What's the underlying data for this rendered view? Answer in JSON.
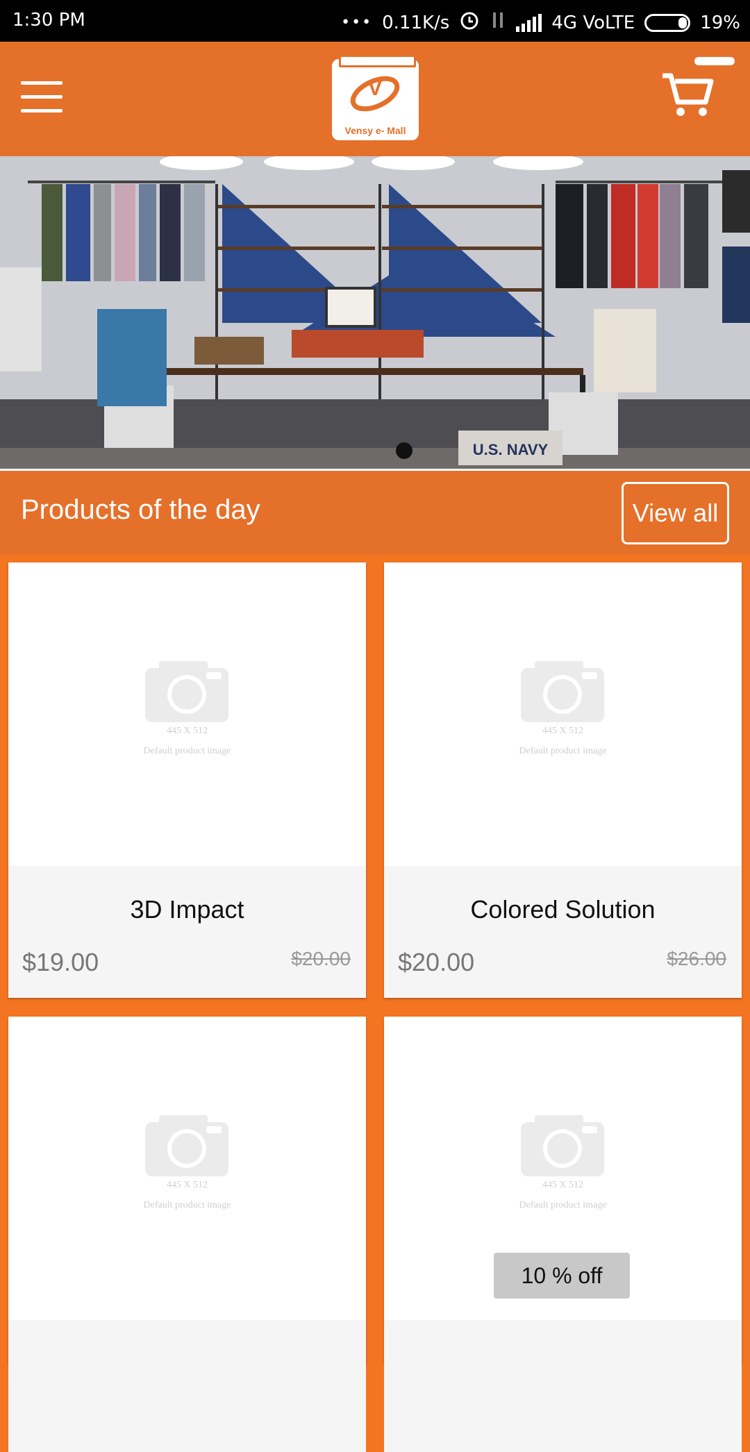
{
  "status_bar": {
    "time": "1:30 PM",
    "dots": "•••",
    "net_speed": "0.11K/s",
    "network": "4G VoLTE",
    "battery": "19%"
  },
  "app_bar": {
    "logo_text": "Vensy e- Mall",
    "logo_letter": "V"
  },
  "banner": {
    "sign_text": "U.S. NAVY"
  },
  "section": {
    "title": "Products of the day",
    "view_all": "View all"
  },
  "products": [
    {
      "name": "3D Impact",
      "price": "$19.00",
      "old_price": "$20.00",
      "placeholder_size": "445 X 512",
      "placeholder_label": "Default product image"
    },
    {
      "name": "Colored Solution",
      "price": "$20.00",
      "old_price": "$26.00",
      "placeholder_size": "445 X 512",
      "placeholder_label": "Default product image"
    },
    {
      "placeholder_size": "445 X 512",
      "placeholder_label": "Default product image"
    },
    {
      "placeholder_size": "445 X 512",
      "placeholder_label": "Default product image",
      "badge": "10 % off"
    }
  ],
  "colors": {
    "brand_orange": "#e5702a",
    "page_orange": "#f37521"
  }
}
